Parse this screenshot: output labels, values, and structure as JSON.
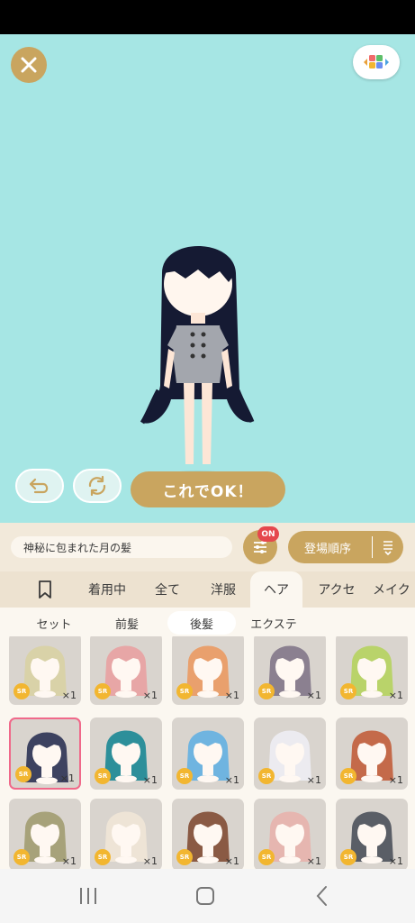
{
  "stage": {
    "ok_label": "これでOK！"
  },
  "info": {
    "item_name": "神秘に包まれた月の髪",
    "on_badge": "ON",
    "sort_label": "登場順序"
  },
  "tabs": [
    "着用中",
    "全て",
    "洋服",
    "ヘア",
    "アクセ",
    "メイク"
  ],
  "active_tab": 3,
  "subtabs": [
    "セット",
    "前髪",
    "後髪",
    "エクステ"
  ],
  "active_subtab": 2,
  "items": [
    {
      "rarity": "SR",
      "qty": "×1",
      "hair": "#d9d2a8"
    },
    {
      "rarity": "SR",
      "qty": "×1",
      "hair": "#e7a6a6"
    },
    {
      "rarity": "SR",
      "qty": "×1",
      "hair": "#e9a06d"
    },
    {
      "rarity": "SR",
      "qty": "×1",
      "hair": "#8b8090"
    },
    {
      "rarity": "SR",
      "qty": "×1",
      "hair": "#b9d36a"
    },
    {
      "rarity": "SR",
      "qty": "×1",
      "hair": "#3d4260"
    },
    {
      "rarity": "SR",
      "qty": "×1",
      "hair": "#2d8f9a"
    },
    {
      "rarity": "SR",
      "qty": "×1",
      "hair": "#6fb4e0"
    },
    {
      "rarity": "SR",
      "qty": "×1",
      "hair": "#ecebf0"
    },
    {
      "rarity": "SR",
      "qty": "×1",
      "hair": "#c46a4a"
    },
    {
      "rarity": "SR",
      "qty": "×1",
      "hair": "#a7a27a"
    },
    {
      "rarity": "SR",
      "qty": "×1",
      "hair": "#eee4d6"
    },
    {
      "rarity": "SR",
      "qty": "×1",
      "hair": "#8a5a44"
    },
    {
      "rarity": "SR",
      "qty": "×1",
      "hair": "#e6b6b0"
    },
    {
      "rarity": "SR",
      "qty": "×1",
      "hair": "#5a5e66"
    }
  ],
  "selected_item": 5,
  "colors": {
    "stage_bg": "#a6e6e4",
    "accent_gold": "#c9a55f",
    "badge_red": "#e5484d",
    "selected_border": "#f0698a"
  }
}
